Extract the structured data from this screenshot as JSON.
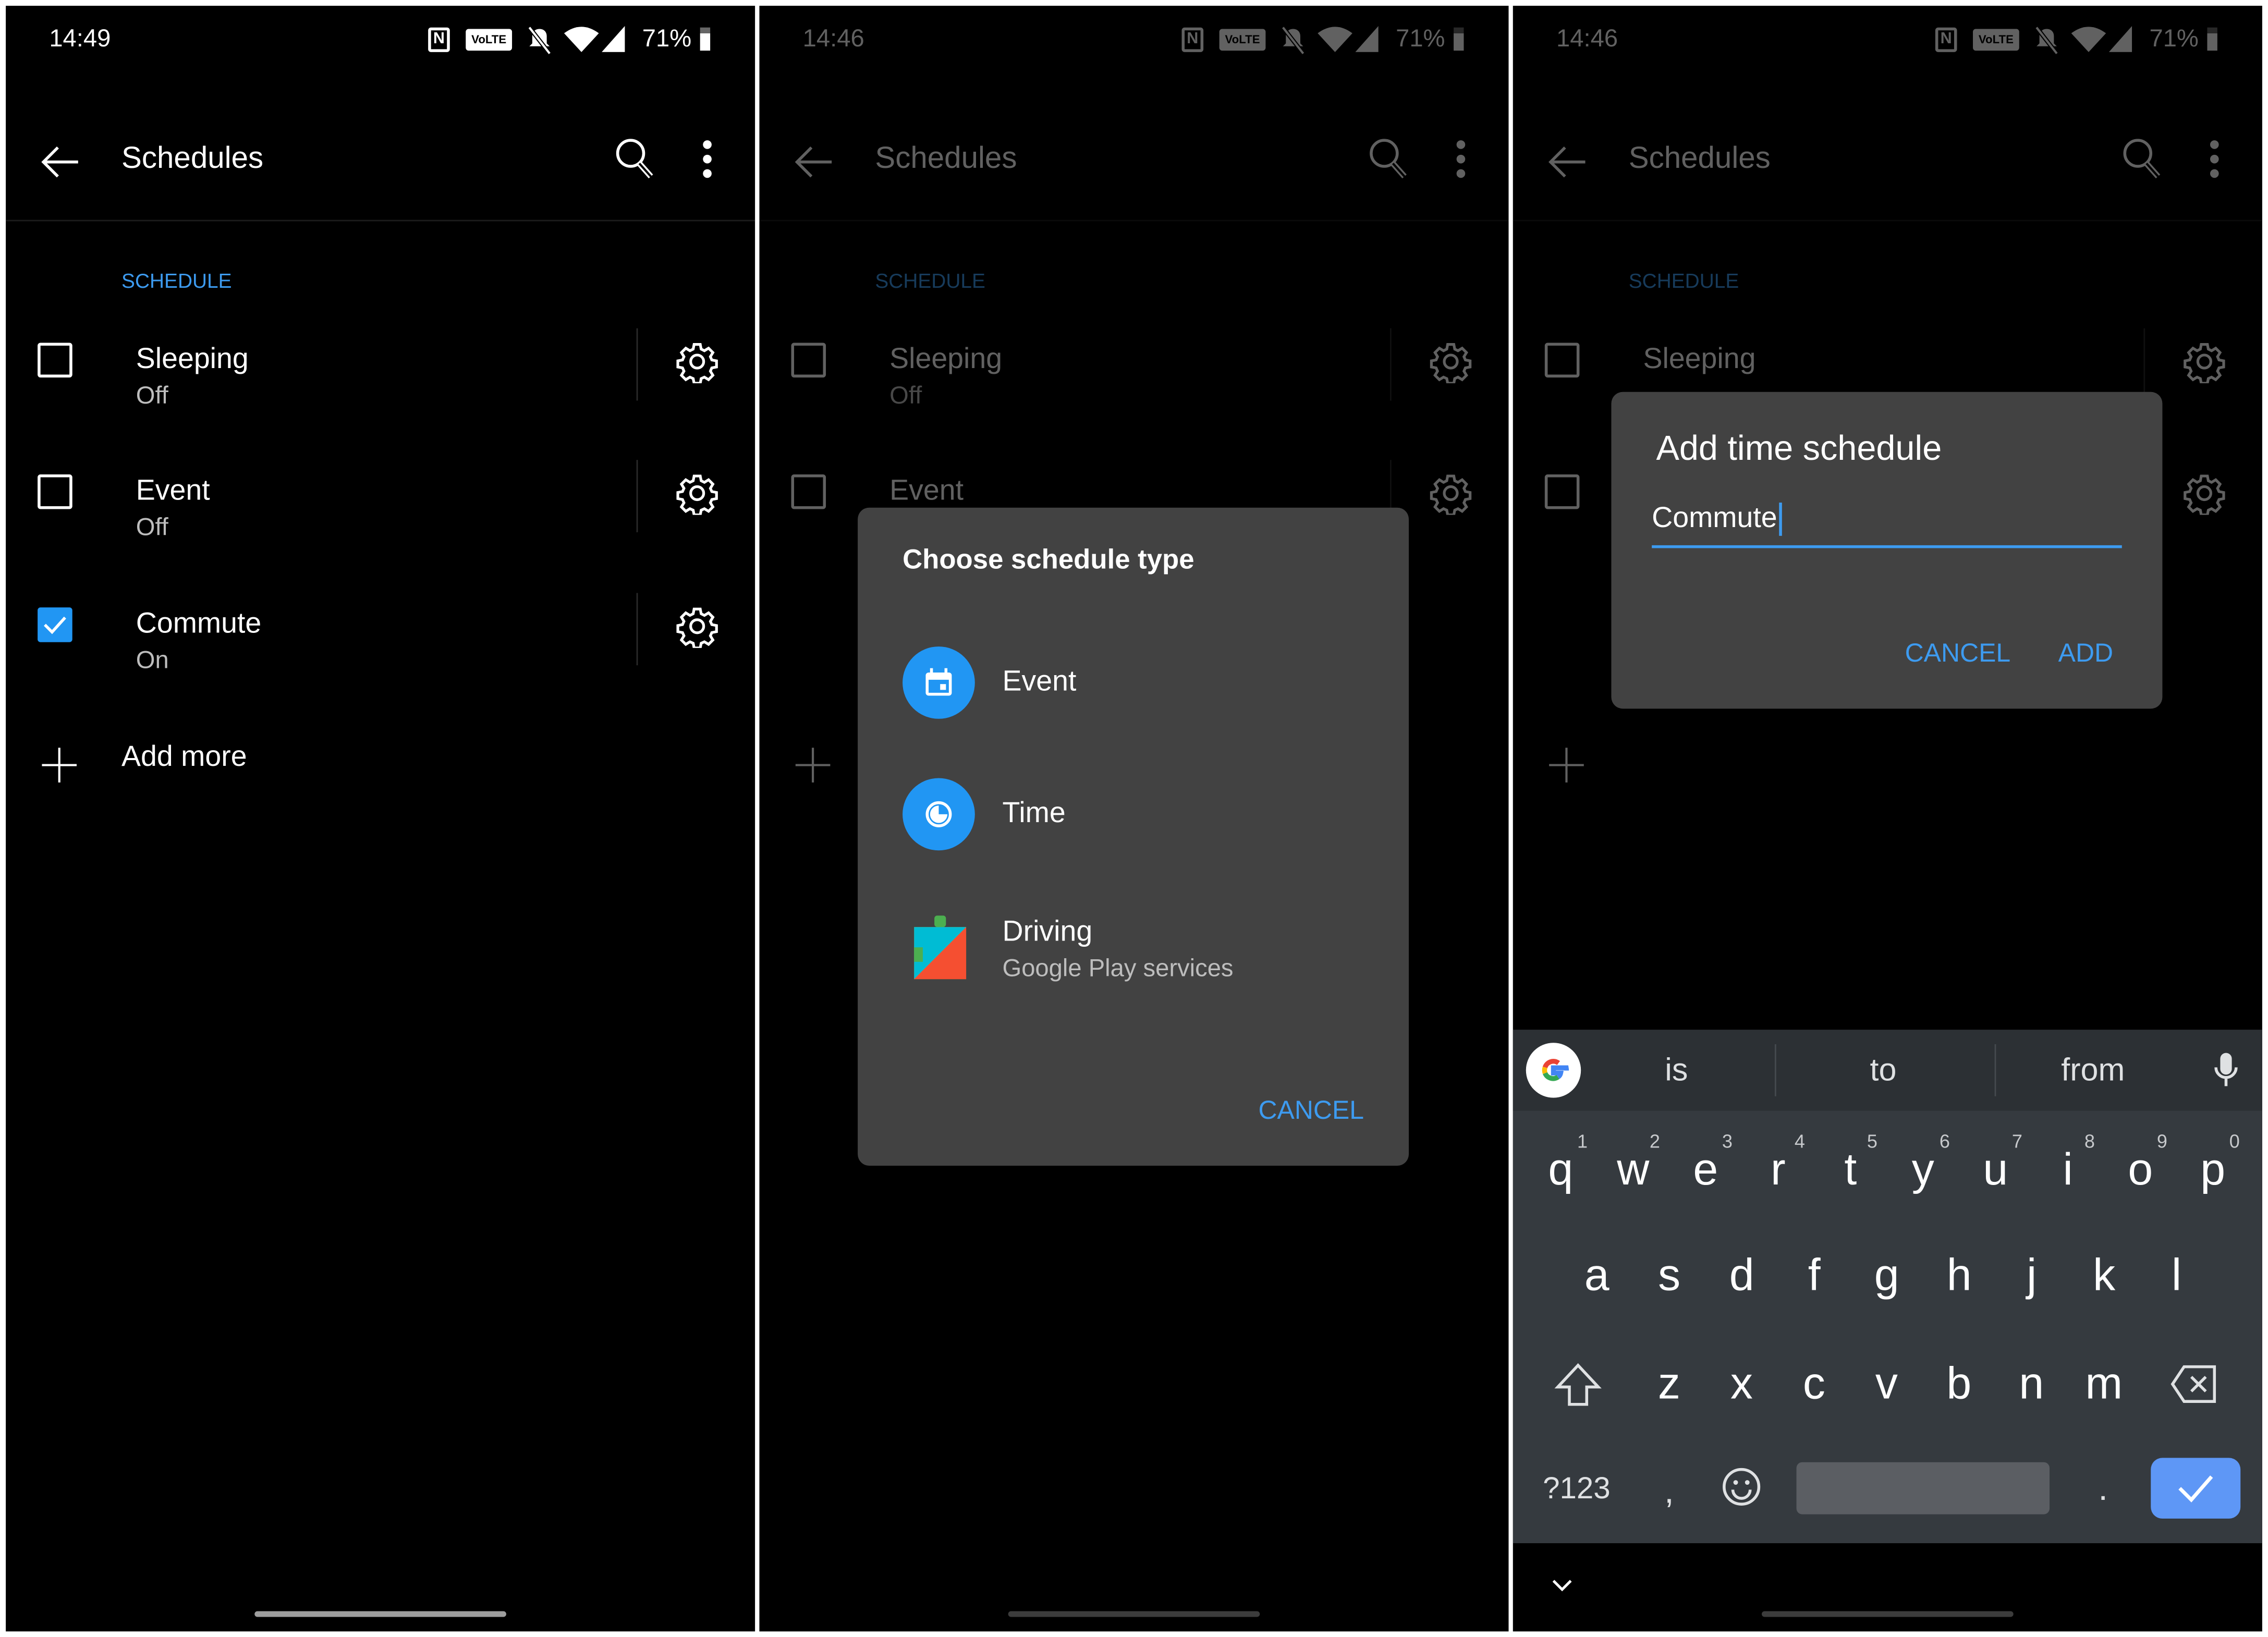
{
  "colors": {
    "accent": "#3d9bf0",
    "checkbox_checked": "#2196f3",
    "dialog_bg": "#424242",
    "keyboard_bg": "#353a3f",
    "enter_key": "#5e97f6"
  },
  "panels": [
    {
      "status": {
        "time": "14:49",
        "battery": "71%",
        "volte": "VoLTE"
      },
      "toolbar": {
        "title": "Schedules"
      },
      "section": "SCHEDULE",
      "items": [
        {
          "title": "Sleeping",
          "subtitle": "Off",
          "checked": false
        },
        {
          "title": "Event",
          "subtitle": "Off",
          "checked": false
        },
        {
          "title": "Commute",
          "subtitle": "On",
          "checked": true
        }
      ],
      "add_more": "Add more"
    },
    {
      "status": {
        "time": "14:46",
        "battery": "71%",
        "volte": "VoLTE"
      },
      "toolbar": {
        "title": "Schedules"
      },
      "section": "SCHEDULE",
      "items": [
        {
          "title": "Sleeping",
          "subtitle": "Off",
          "checked": false
        },
        {
          "title": "Event",
          "subtitle": "",
          "checked": false
        }
      ],
      "dialog": {
        "title": "Choose schedule type",
        "options": [
          {
            "label": "Event",
            "icon": "calendar-icon"
          },
          {
            "label": "Time",
            "icon": "clock-icon"
          },
          {
            "label": "Driving",
            "sublabel": "Google Play services",
            "icon": "google-play-services-icon"
          }
        ],
        "cancel": "CANCEL"
      }
    },
    {
      "status": {
        "time": "14:46",
        "battery": "71%",
        "volte": "VoLTE"
      },
      "toolbar": {
        "title": "Schedules"
      },
      "section": "SCHEDULE",
      "items": [
        {
          "title": "Sleeping",
          "subtitle": "",
          "checked": false
        },
        {
          "title": "",
          "subtitle": "",
          "checked": false
        }
      ],
      "dialog": {
        "title": "Add time schedule",
        "input_value": "Commute",
        "cancel": "CANCEL",
        "add": "ADD"
      },
      "keyboard": {
        "suggestions": [
          "is",
          "to",
          "from"
        ],
        "row1": [
          "q",
          "w",
          "e",
          "r",
          "t",
          "y",
          "u",
          "i",
          "o",
          "p"
        ],
        "row1_numbers": [
          "1",
          "2",
          "3",
          "4",
          "5",
          "6",
          "7",
          "8",
          "9",
          "0"
        ],
        "row2": [
          "a",
          "s",
          "d",
          "f",
          "g",
          "h",
          "j",
          "k",
          "l"
        ],
        "row3": [
          "z",
          "x",
          "c",
          "v",
          "b",
          "n",
          "m"
        ],
        "symbols_key": "?123",
        "comma": ",",
        "period": "."
      }
    }
  ]
}
